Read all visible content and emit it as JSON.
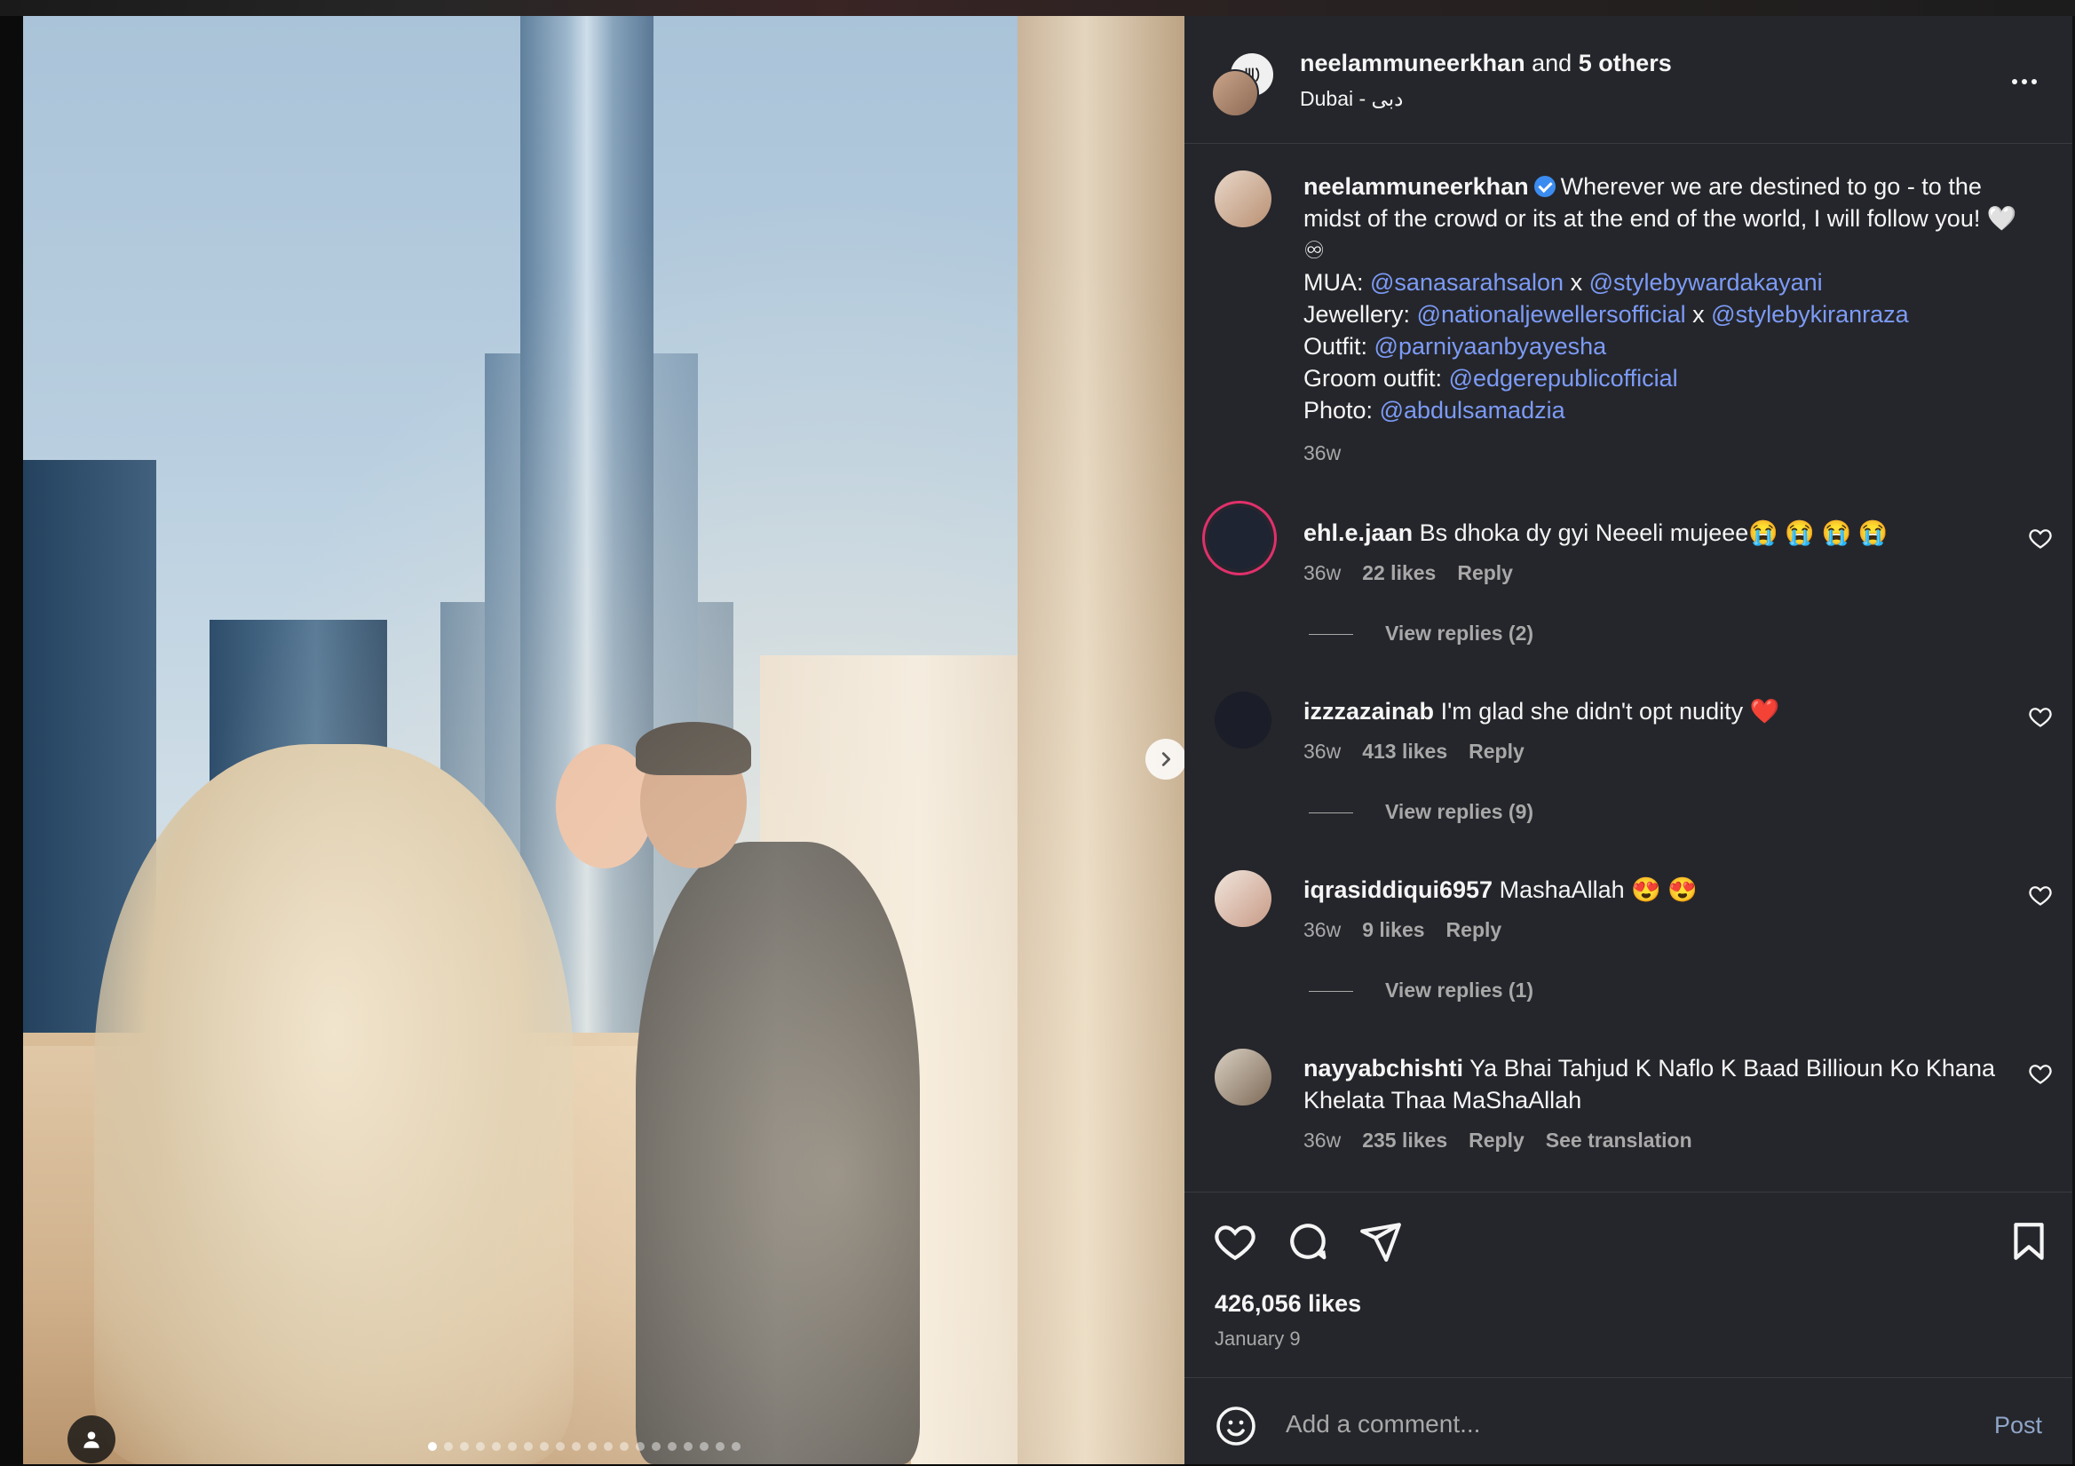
{
  "post": {
    "author": "neelammuneerkhan",
    "coauthors": "and 5 others",
    "coauthors_count": "5 others",
    "location": "Dubai - دبی",
    "caption": {
      "text_main": "Wherever we are destined to go - to the midst of the crowd or its at the end of the world, I will follow you! 🤍 ♾",
      "mua_label": "MUA:",
      "mua_1": "@sanasarahsalon",
      "x": "x",
      "mua_2": "@stylebywardakayani",
      "jewellery_label": "Jewellery:",
      "jewellery_1": "@nationaljewellersofficial",
      "jewellery_2": "@stylebykiranraza",
      "outfit_label": "Outfit:",
      "outfit": "@parniyaanbyayesha",
      "groom_label": "Groom outfit:",
      "groom": "@edgerepublicofficial",
      "photo_label": "Photo:",
      "photo": "@abdulsamadzia",
      "time": "36w"
    },
    "likes": "426,056 likes",
    "date": "January 9",
    "carousel": {
      "total": 20,
      "active": 1
    }
  },
  "comments": [
    {
      "user": "ehl.e.jaan",
      "text": "Bs dhoka dy gyi Neeeli mujeee😭 😭 😭 😭",
      "time": "36w",
      "likes": "22 likes",
      "reply": "Reply",
      "view_replies": "View replies (2)"
    },
    {
      "user": "izzzazainab",
      "text": "I'm glad she didn't opt nudity ❤️",
      "time": "36w",
      "likes": "413 likes",
      "reply": "Reply",
      "view_replies": "View replies (9)"
    },
    {
      "user": "iqrasiddiqui6957",
      "text": "MashaAllah 😍 😍",
      "time": "36w",
      "likes": "9 likes",
      "reply": "Reply",
      "view_replies": "View replies (1)"
    },
    {
      "user": "nayyabchishti",
      "text": "Ya Bhai Tahjud K Naflo K Baad Billioun Ko Khana Khelata Thaa MaShaAllah",
      "time": "36w",
      "likes": "235 likes",
      "reply": "Reply",
      "see_translation": "See translation"
    }
  ],
  "composer": {
    "placeholder": "Add a comment...",
    "post_label": "Post"
  },
  "icons": {
    "like": "heart-icon",
    "comment": "comment-icon",
    "share": "send-icon",
    "save": "bookmark-icon",
    "more": "more-icon",
    "next": "chevron-right-icon",
    "tags": "user-tag-icon",
    "emoji": "emoji-icon",
    "verified": "verified-badge-icon"
  },
  "colors": {
    "panel_bg": "#25262b",
    "mention": "#7c9bf6",
    "muted": "#a8a8a8",
    "verified": "#3b8cf0"
  }
}
